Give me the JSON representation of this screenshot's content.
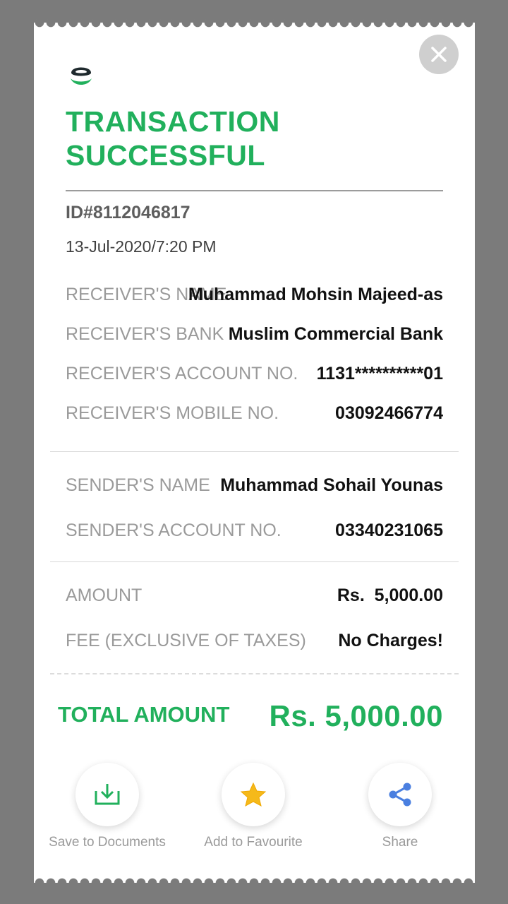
{
  "header": {
    "title_line1": "TRANSACTION",
    "title_line2": "SUCCESSFUL",
    "transaction_id": "ID#8112046817",
    "datetime": "13-Jul-2020/7:20 PM"
  },
  "receiver": [
    {
      "label": "RECEIVER'S NAME",
      "value": "Muhammad Mohsin Majeed-as"
    },
    {
      "label": "RECEIVER'S BANK",
      "value": "Muslim Commercial Bank"
    },
    {
      "label": "RECEIVER'S ACCOUNT NO.",
      "value": "1131**********01"
    },
    {
      "label": "RECEIVER'S MOBILE NO.",
      "value": "03092466774"
    }
  ],
  "sender": [
    {
      "label": "SENDER'S NAME",
      "value": "Muhammad Sohail Younas"
    },
    {
      "label": "SENDER'S ACCOUNT NO.",
      "value": "03340231065"
    }
  ],
  "charges": [
    {
      "label": "AMOUNT",
      "value": "Rs.  5,000.00"
    },
    {
      "label": "FEE (EXCLUSIVE OF TAXES)",
      "value": "No Charges!"
    }
  ],
  "total": {
    "label": "TOTAL AMOUNT",
    "value": "Rs. 5,000.00"
  },
  "actions": [
    {
      "label": "Save to Documents",
      "icon": "download-icon"
    },
    {
      "label": "Add to Favourite",
      "icon": "star-icon"
    },
    {
      "label": "Share",
      "icon": "share-icon"
    }
  ],
  "colors": {
    "brand_green": "#21b05c",
    "star_yellow": "#f5b91a",
    "share_blue": "#4a7fe0",
    "backdrop": "#7b7b7b"
  }
}
